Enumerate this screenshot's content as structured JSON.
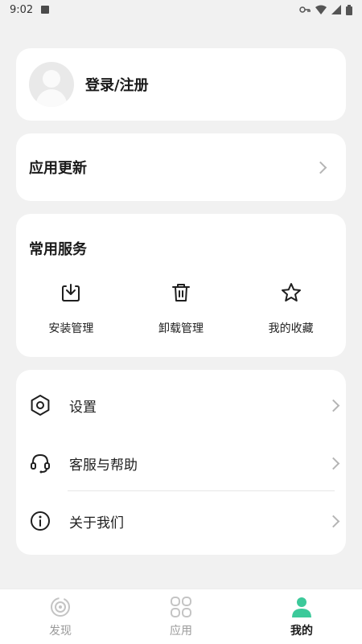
{
  "status_bar": {
    "time": "9:02"
  },
  "login": {
    "label": "登录/注册"
  },
  "update": {
    "label": "应用更新"
  },
  "services": {
    "title": "常用服务",
    "items": [
      {
        "label": "安装管理",
        "icon": "install-icon"
      },
      {
        "label": "卸载管理",
        "icon": "trash-icon"
      },
      {
        "label": "我的收藏",
        "icon": "star-icon"
      }
    ]
  },
  "menu": {
    "items": [
      {
        "label": "设置",
        "icon": "gear-icon"
      },
      {
        "label": "客服与帮助",
        "icon": "headset-icon"
      },
      {
        "label": "关于我们",
        "icon": "info-icon"
      }
    ]
  },
  "bottom_nav": {
    "items": [
      {
        "label": "发现",
        "icon": "discover-icon"
      },
      {
        "label": "应用",
        "icon": "apps-icon"
      },
      {
        "label": "我的",
        "icon": "profile-icon",
        "active": true
      }
    ]
  },
  "colors": {
    "accent": "#3cc99a",
    "background": "#f1f1f1",
    "card": "#ffffff"
  }
}
